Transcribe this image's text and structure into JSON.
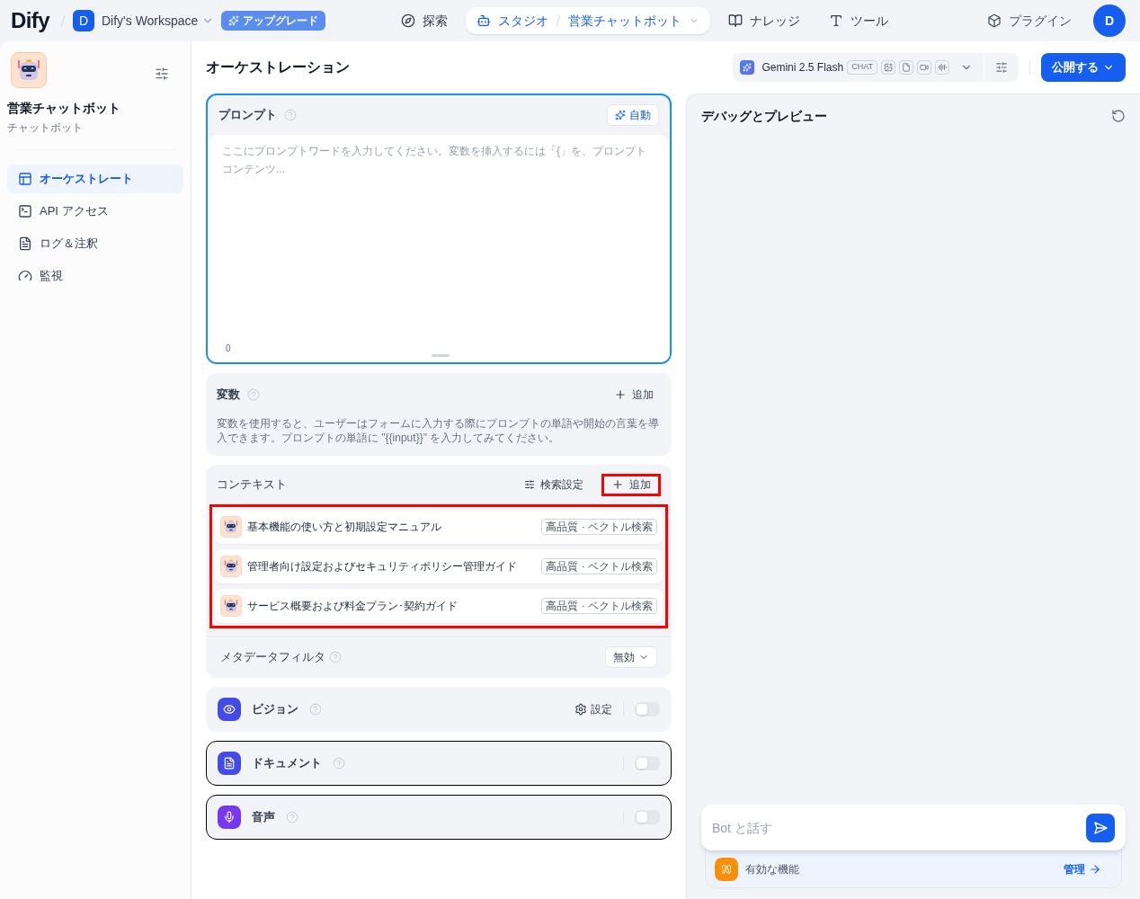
{
  "topbar": {
    "logo": "Dify",
    "workspace_initial": "D",
    "workspace": "Dify's Workspace",
    "upgrade": "アップグレード",
    "nav": [
      {
        "kind": "explore",
        "label": "探索",
        "selected": false
      },
      {
        "kind": "studio",
        "label": "スタジオ",
        "selected": true,
        "app": "営業チャットボット"
      },
      {
        "kind": "knowledge",
        "label": "ナレッジ",
        "selected": false
      },
      {
        "kind": "tools",
        "label": "ツール",
        "selected": false
      }
    ],
    "plugins": "プラグイン",
    "avatar": "D"
  },
  "sidebar": {
    "app_name": "営業チャットボット",
    "app_type": "チャットボット",
    "items": [
      {
        "kind": "orchestrate",
        "label": "オーケストレート",
        "selected": true
      },
      {
        "kind": "api",
        "label": "API アクセス",
        "selected": false
      },
      {
        "kind": "logs",
        "label": "ログ＆注釈",
        "selected": false
      },
      {
        "kind": "monitor",
        "label": "監視",
        "selected": false
      }
    ]
  },
  "header": {
    "title": "オーケストレーション",
    "model": "Gemini 2.5 Flash",
    "model_mode": "CHAT",
    "publish": "公開する"
  },
  "prompt": {
    "title": "プロンプト",
    "auto": "自動",
    "placeholder": "ここにプロンプトワードを入力してください。変数を挿入するには「{」を、プロンプトコンテンツ...",
    "count": "0"
  },
  "variables": {
    "title": "変数",
    "add": "追加",
    "description": "変数を使用すると、ユーザーはフォームに入力する際にプロンプトの単語や開始の言葉を導入できます。プロンプトの単語に \"{{input}}\" を入力してみてください。"
  },
  "context": {
    "title": "コンテキスト",
    "retrieval_settings": "検索設定",
    "add": "追加",
    "add_highlighted": true,
    "items_highlighted": true,
    "items": [
      {
        "name": "基本機能の使い方と初期設定マニュアル",
        "badge": "高品質 · ベクトル検索"
      },
      {
        "name": "管理者向け設定およびセキュリティポリシー管理ガイド",
        "badge": "高品質 · ベクトル検索"
      },
      {
        "name": "サービス概要および料金プラン･契約ガイド",
        "badge": "高品質 · ベクトル検索"
      }
    ],
    "metadata_filter": "メタデータフィルタ",
    "metadata_value": "無効"
  },
  "features": [
    {
      "kind": "vision",
      "label": "ビジョン",
      "settings": "設定",
      "on": false,
      "outlined": false
    },
    {
      "kind": "document",
      "label": "ドキュメント",
      "on": false,
      "outlined": true
    },
    {
      "kind": "audio",
      "label": "音声",
      "on": false,
      "outlined": true
    }
  ],
  "debug": {
    "title": "デバッグとプレビュー",
    "input_placeholder": "Bot と話す",
    "enabled_features": "有効な機能",
    "manage": "管理"
  }
}
